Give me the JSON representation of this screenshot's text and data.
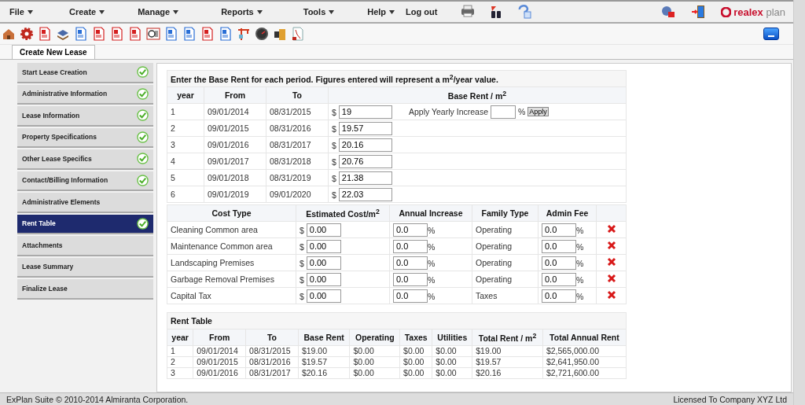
{
  "menu": [
    {
      "label": "File",
      "dropdown": true
    },
    {
      "label": "Create",
      "dropdown": true
    },
    {
      "label": "Manage",
      "dropdown": true
    },
    {
      "label": "Reports",
      "dropdown": true
    },
    {
      "label": "Tools",
      "dropdown": true
    },
    {
      "label": "Help",
      "dropdown": true
    },
    {
      "label": "Log out",
      "dropdown": false
    }
  ],
  "logo": {
    "brand": "realex",
    "suffix": "plan"
  },
  "tab": {
    "label": "Create New Lease",
    "selected": true
  },
  "steps": [
    {
      "label": "Start Lease Creation",
      "done": true,
      "selected": false
    },
    {
      "label": "Administrative Information",
      "done": true,
      "selected": false
    },
    {
      "label": "Lease Information",
      "done": true,
      "selected": false
    },
    {
      "label": "Property Specifications",
      "done": true,
      "selected": false
    },
    {
      "label": "Other Lease Specifics",
      "done": true,
      "selected": false
    },
    {
      "label": "Contact/Billing Information",
      "done": true,
      "selected": false
    },
    {
      "label": "Administrative Elements",
      "done": false,
      "selected": false
    },
    {
      "label": "Rent Table",
      "done": true,
      "selected": true
    },
    {
      "label": "Attachments",
      "done": false,
      "selected": false
    },
    {
      "label": "Lease Summary",
      "done": false,
      "selected": false
    },
    {
      "label": "Finalize Lease",
      "done": false,
      "selected": false
    }
  ],
  "base_rent": {
    "instruction": "Enter the Base Rent for each period. Figures entered will represent a m$^{2}$/year value.",
    "columns": [
      "year",
      "From",
      "To",
      "Base Rent / m$^{2}$"
    ],
    "currency": "$",
    "rows": [
      {
        "year": "1",
        "from": "09/01/2014",
        "to": "08/31/2015",
        "value": "19"
      },
      {
        "year": "2",
        "from": "09/01/2015",
        "to": "08/31/2016",
        "value": "19.57"
      },
      {
        "year": "3",
        "from": "09/01/2016",
        "to": "08/31/2017",
        "value": "20.16"
      },
      {
        "year": "4",
        "from": "09/01/2017",
        "to": "08/31/2018",
        "value": "20.76"
      },
      {
        "year": "5",
        "from": "09/01/2018",
        "to": "08/31/2019",
        "value": "21.38"
      },
      {
        "year": "6",
        "from": "09/01/2019",
        "to": "09/01/2020",
        "value": "22.03"
      }
    ],
    "increase_label": "Apply Yearly Increase",
    "percent": "%",
    "apply_button": "Apply"
  },
  "costs": {
    "columns": [
      "Cost Type",
      "Estimated Cost/m$^{2}$",
      "Annual Increase",
      "Family Type",
      "Admin Fee"
    ],
    "currency": "$",
    "percent": "%",
    "rows": [
      {
        "name": "Cleaning Common area",
        "cost": "0.00",
        "increase": "0.0",
        "family": "Operating",
        "fee": "0.0"
      },
      {
        "name": "Maintenance Common area",
        "cost": "0.00",
        "increase": "0.0",
        "family": "Operating",
        "fee": "0.0"
      },
      {
        "name": "Landscaping Premises",
        "cost": "0.00",
        "increase": "0.0",
        "family": "Operating",
        "fee": "0.0"
      },
      {
        "name": "Garbage Removal Premises",
        "cost": "0.00",
        "increase": "0.0",
        "family": "Operating",
        "fee": "0.0"
      },
      {
        "name": "Capital Tax",
        "cost": "0.00",
        "increase": "0.0",
        "family": "Taxes",
        "fee": "0.0"
      }
    ]
  },
  "rent_table": {
    "title": "Rent Table",
    "columns": [
      "year",
      "From",
      "To",
      "Base Rent",
      "Operating",
      "Taxes",
      "Utilities",
      "Total Rent / m$^{2}$",
      "Total Annual Rent"
    ],
    "rows": [
      [
        "1",
        "09/01/2014",
        "08/31/2015",
        "$19.00",
        "$0.00",
        "$0.00",
        "$0.00",
        "$19.00",
        "$2,565,000.00"
      ],
      [
        "2",
        "09/01/2015",
        "08/31/2016",
        "$19.57",
        "$0.00",
        "$0.00",
        "$0.00",
        "$19.57",
        "$2,641,950.00"
      ],
      [
        "3",
        "09/01/2016",
        "08/31/2017",
        "$20.16",
        "$0.00",
        "$0.00",
        "$0.00",
        "$20.16",
        "$2,721,600.00"
      ]
    ]
  },
  "status_bar": {
    "left": "ExPlan Suite © 2010-2014 Almiranta Corporation.",
    "right": "Licensed To Company XYZ Ltd"
  }
}
